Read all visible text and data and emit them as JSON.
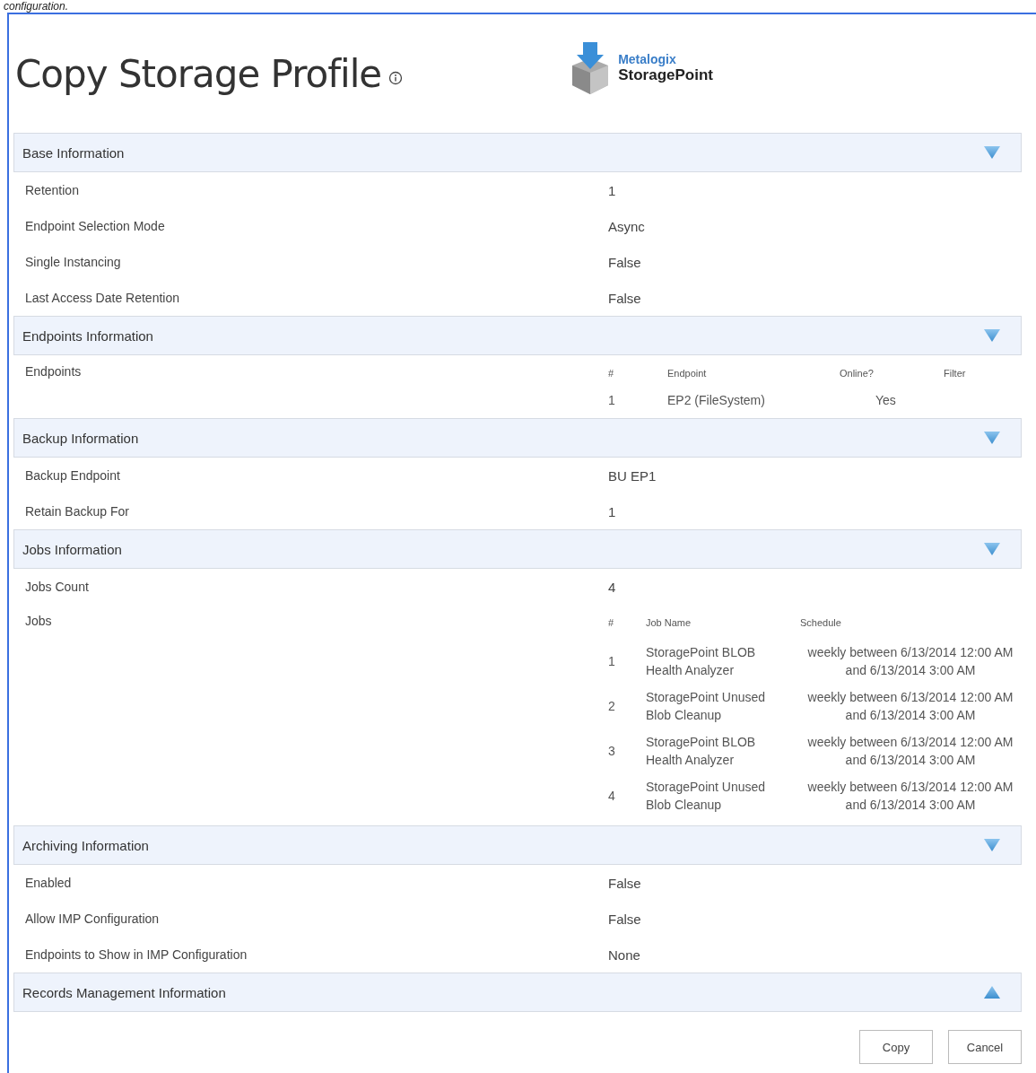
{
  "top_text": "configuration.",
  "title": "Copy Storage Profile",
  "logo": {
    "brand": "Metalogix",
    "product": "StoragePoint"
  },
  "sections": [
    {
      "title": "Base Information",
      "expanded": true,
      "rows": [
        {
          "kind": "text",
          "label": "Retention",
          "value": "1"
        },
        {
          "kind": "text",
          "label": "Endpoint Selection Mode",
          "value": "Async"
        },
        {
          "kind": "text",
          "label": "Single Instancing",
          "value": "False"
        },
        {
          "kind": "text",
          "label": "Last Access Date Retention",
          "value": "False"
        }
      ]
    },
    {
      "title": "Endpoints Information",
      "expanded": true,
      "rows": [
        {
          "kind": "table",
          "label": "Endpoints",
          "columns": [
            "#",
            "Endpoint",
            "Online?",
            "Filter"
          ],
          "rows": [
            [
              "1",
              "EP2 (FileSystem)",
              "Yes"
            ]
          ]
        }
      ]
    },
    {
      "title": "Backup Information",
      "expanded": true,
      "rows": [
        {
          "kind": "text",
          "label": "Backup Endpoint",
          "value": "BU EP1"
        },
        {
          "kind": "text",
          "label": "Retain Backup For",
          "value": "1"
        }
      ]
    },
    {
      "title": "Jobs Information",
      "expanded": true,
      "rows": [
        {
          "kind": "text",
          "label": "Jobs Count",
          "value": "4"
        },
        {
          "kind": "table",
          "label": "Jobs",
          "columns": [
            "#",
            "Job Name",
            "Schedule"
          ],
          "rows": [
            [
              "1",
              "StoragePoint BLOB Health Analyzer",
              "weekly between 6/13/2014 12:00 AM and 6/13/2014 3:00 AM"
            ],
            [
              "2",
              "StoragePoint Unused Blob Cleanup",
              "weekly between 6/13/2014 12:00 AM and 6/13/2014 3:00 AM"
            ],
            [
              "3",
              "StoragePoint BLOB Health Analyzer",
              "weekly between 6/13/2014 12:00 AM and 6/13/2014 3:00 AM"
            ],
            [
              "4",
              "StoragePoint Unused Blob Cleanup",
              "weekly between 6/13/2014 12:00 AM and 6/13/2014 3:00 AM"
            ]
          ]
        }
      ]
    },
    {
      "title": "Archiving Information",
      "expanded": true,
      "rows": [
        {
          "kind": "text",
          "label": "Enabled",
          "value": "False"
        },
        {
          "kind": "text",
          "label": "Allow IMP Configuration",
          "value": "False"
        },
        {
          "kind": "text",
          "label": "Endpoints to Show in IMP Configuration",
          "value": "None"
        }
      ]
    },
    {
      "title": "Records Management Information",
      "expanded": false
    }
  ],
  "buttons": [
    "Copy",
    "Cancel"
  ]
}
